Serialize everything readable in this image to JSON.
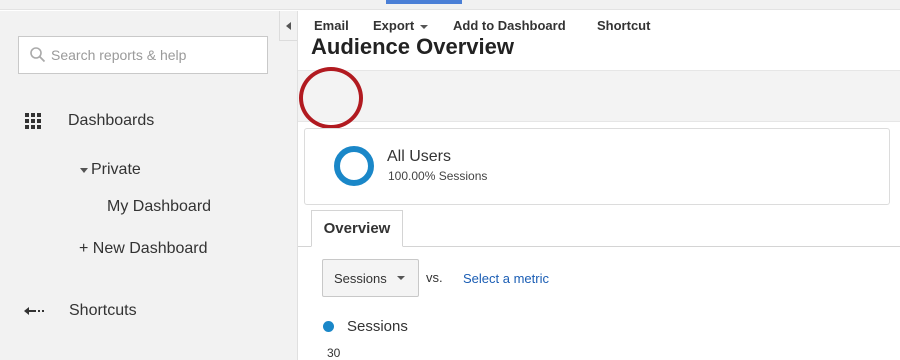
{
  "sidebar": {
    "search_placeholder": "Search reports & help",
    "dashboards_label": "Dashboards",
    "private_label": "Private",
    "my_dashboard_label": "My Dashboard",
    "new_dashboard_label": "+ New Dashboard",
    "shortcuts_label": "Shortcuts"
  },
  "main": {
    "title": "Audience Overview",
    "toolbar": {
      "email_label": "Email",
      "export_label": "Export",
      "add_to_dashboard_label": "Add to Dashboard",
      "shortcut_label": "Shortcut"
    },
    "segment": {
      "name": "All Users",
      "subtitle": "100.00% Sessions"
    },
    "tabs": [
      {
        "label": "Overview"
      }
    ],
    "metric": {
      "selected": "Sessions",
      "vs_label": "vs.",
      "select_metric_link": "Select a metric"
    },
    "chart": {
      "legend_label": "Sessions",
      "top_value": "30"
    }
  },
  "colors": {
    "accent": "#1a87c8",
    "highlight_circle": "#b11a20",
    "link": "#1a5db4"
  },
  "icons": [
    "search-icon",
    "dashboard-grid-icon",
    "caret-down-icon",
    "shortcuts-arrow-icon",
    "collapse-arrow-icon"
  ]
}
